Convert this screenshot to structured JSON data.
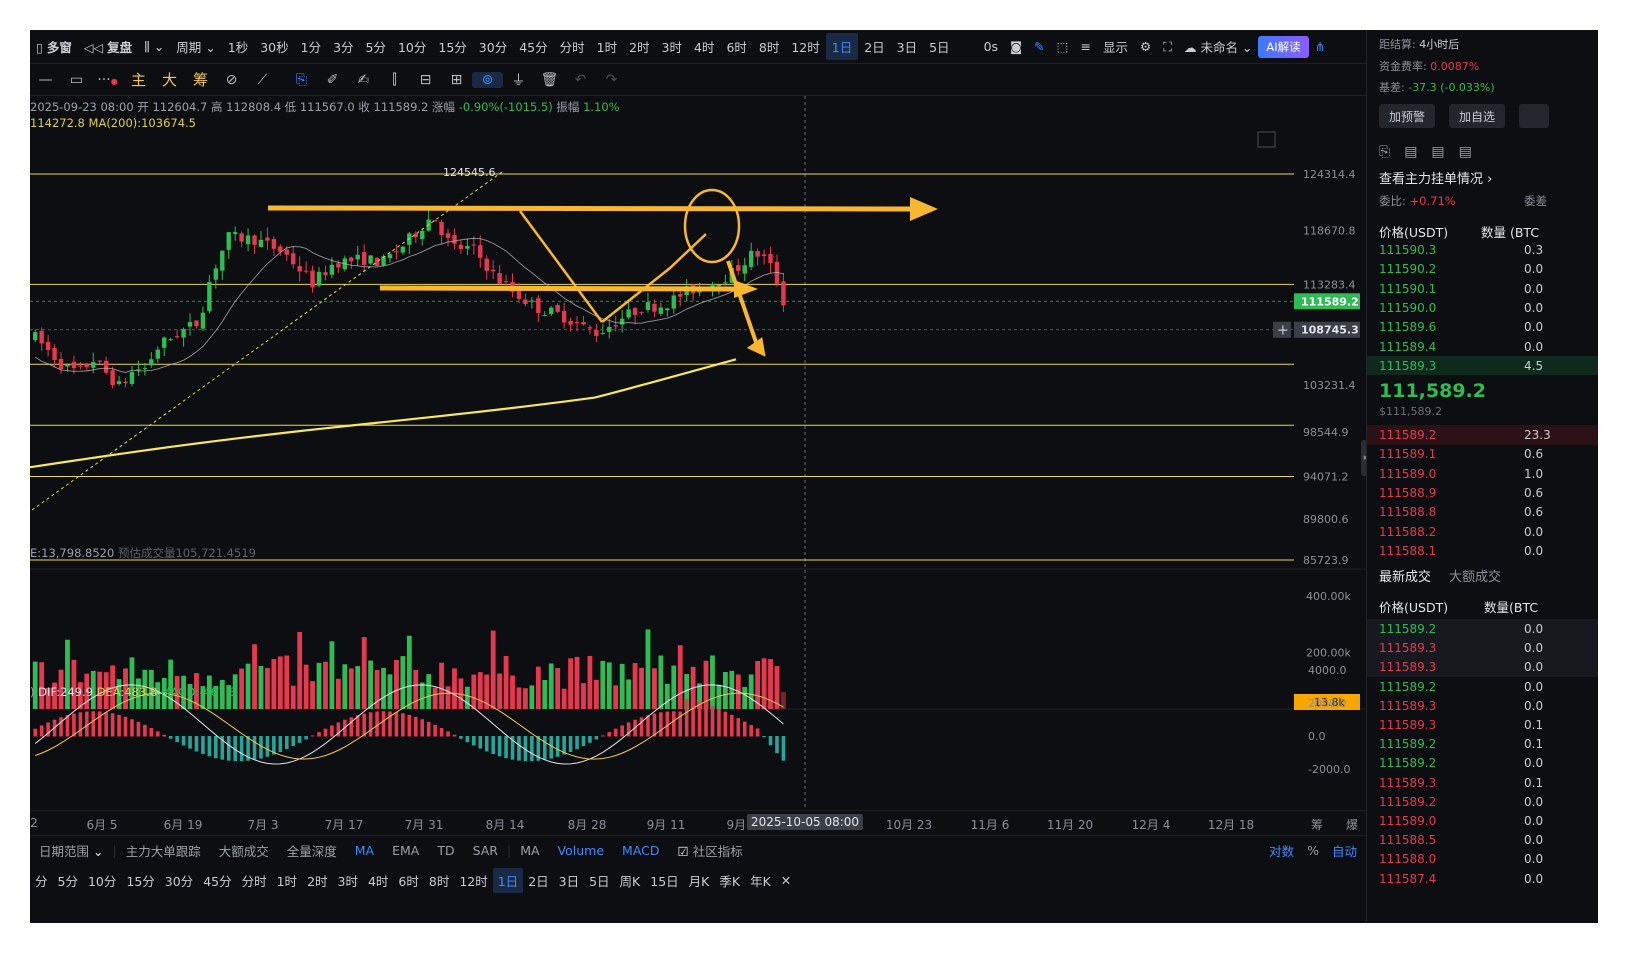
{
  "toolbar_top": {
    "items": [
      "多窗",
      "复盘",
      "周期",
      "1秒",
      "30秒",
      "1分",
      "3分",
      "5分",
      "10分",
      "15分",
      "30分",
      "45分",
      "分时",
      "1时",
      "2时",
      "3时",
      "4时",
      "6时",
      "8时",
      "12时",
      "1日",
      "2日",
      "3日",
      "5日",
      "0s",
      "显示",
      "未命名",
      "AI解读"
    ],
    "active": "1日"
  },
  "toolbar_draw": {
    "labels": [
      "主",
      "大",
      "筹"
    ]
  },
  "info": {
    "date": "2025-09-23 08:00",
    "open_label": "开",
    "open": "112604.7",
    "high_label": "高",
    "high": "112808.4",
    "low_label": "低",
    "low": "111567.0",
    "close_label": "收",
    "close": "111589.2",
    "change_label": "涨幅",
    "change": "-0.90%(-1015.5)",
    "amp_label": "振幅",
    "amp": "1.10%",
    "ma_left": "114272.8",
    "ma200": "MA(200):103674.5"
  },
  "volume_info": {
    "main": "E:13,798.8520",
    "est_label": "预估成交量",
    "est": "105,721.4519"
  },
  "macd_info": {
    "prefix": ")",
    "dif": "DIF:249.9",
    "dea": "DEA:483.8",
    "macd": "MACD:-467.8"
  },
  "chart_data": {
    "type": "candlestick",
    "price_ticks": [
      "124314.4",
      "118670.8",
      "113283.4",
      "103231.4",
      "98544.9",
      "94071.2",
      "89800.6",
      "85723.9"
    ],
    "current_price_tag": "111589.2",
    "crosshair_price_tag": "108745.3",
    "peak_label": "124545.6",
    "hlines": [
      124314.4,
      113283.4,
      105300,
      99200,
      94071.2,
      85723.9
    ],
    "volume_ticks": [
      "400.00k",
      "200.00k"
    ],
    "volume_tag": "13.8k",
    "macd_ticks": [
      "4000.0",
      "2000.0",
      "0.0",
      "-2000.0"
    ],
    "date_labels": [
      "2",
      "6月 5",
      "6月 19",
      "7月 3",
      "7月 17",
      "7月 31",
      "8月 14",
      "8月 28",
      "9月 11",
      "9月 2",
      "2025-10-05 08:00",
      "10月 23",
      "11月 6",
      "11月 20",
      "12月 4",
      "12月 18",
      "筹",
      "爆"
    ],
    "colors": {
      "up": "#2ebd55",
      "down": "#e8384f",
      "ma200": "#f5e663",
      "ma": "#b8b8b8",
      "arrow": "#f7b731",
      "hline": "#e6d84a"
    }
  },
  "bottom_bar": {
    "items": [
      "日期范围",
      "主力大单跟踪",
      "大额成交",
      "全量深度",
      "MA",
      "EMA",
      "TD",
      "SAR",
      "MA",
      "Volume",
      "MACD",
      "社区指标",
      "对数",
      "%",
      "自动"
    ]
  },
  "bottom_periods": {
    "items": [
      "分",
      "5分",
      "10分",
      "15分",
      "30分",
      "45分",
      "分时",
      "1时",
      "2时",
      "3时",
      "4时",
      "6时",
      "8时",
      "12时",
      "1日",
      "2日",
      "3日",
      "5日",
      "周K",
      "15日",
      "月K",
      "季K",
      "年K",
      "✕"
    ],
    "active": "1日"
  },
  "right_panel": {
    "settle_label": "距结算:",
    "settle_value": "4小时后",
    "funding_label": "资金费率:",
    "funding_value": "0.0087%",
    "basis_label": "基差:",
    "basis_value": "-37.3 (-0.033%)",
    "btn_alert": "加预警",
    "btn_fav": "加自选",
    "main_orders": "查看主力挂单情况",
    "ratio_label": "委比:",
    "ratio_value": "+0.71%",
    "ratio_right": "委差",
    "col_price": "价格(USDT)",
    "col_qty": "数量 (BTC",
    "bids": [
      {
        "p": "111590.3",
        "q": "0.3"
      },
      {
        "p": "111590.2",
        "q": "0.0"
      },
      {
        "p": "111590.1",
        "q": "0.0"
      },
      {
        "p": "111590.0",
        "q": "0.0"
      },
      {
        "p": "111589.6",
        "q": "0.0"
      },
      {
        "p": "111589.4",
        "q": "0.0"
      },
      {
        "p": "111589.3",
        "q": "4.5"
      }
    ],
    "last_price": "111,589.2",
    "last_usd": "$111,589.2",
    "asks": [
      {
        "p": "111589.2",
        "q": "23.3"
      },
      {
        "p": "111589.1",
        "q": "0.6"
      },
      {
        "p": "111589.0",
        "q": "1.0"
      },
      {
        "p": "111588.9",
        "q": "0.6"
      },
      {
        "p": "111588.8",
        "q": "0.6"
      },
      {
        "p": "111588.2",
        "q": "0.0"
      },
      {
        "p": "111588.1",
        "q": "0.0"
      }
    ],
    "trades_tab1": "最新成交",
    "trades_tab2": "大额成交",
    "trades_col_price": "价格(USDT)",
    "trades_col_qty": "数量(BTC",
    "trades": [
      {
        "p": "111589.2",
        "q": "0.0",
        "s": "g"
      },
      {
        "p": "111589.3",
        "q": "0.0",
        "s": "r"
      },
      {
        "p": "111589.3",
        "q": "0.0",
        "s": "r"
      },
      {
        "p": "111589.2",
        "q": "0.0",
        "s": "g"
      },
      {
        "p": "111589.3",
        "q": "0.0",
        "s": "r"
      },
      {
        "p": "111589.3",
        "q": "0.1",
        "s": "r"
      },
      {
        "p": "111589.2",
        "q": "0.1",
        "s": "g"
      },
      {
        "p": "111589.2",
        "q": "0.0",
        "s": "g"
      },
      {
        "p": "111589.3",
        "q": "0.1",
        "s": "r"
      },
      {
        "p": "111589.2",
        "q": "0.0",
        "s": "r"
      },
      {
        "p": "111589.0",
        "q": "0.0",
        "s": "r"
      },
      {
        "p": "111588.5",
        "q": "0.0",
        "s": "r"
      },
      {
        "p": "111588.0",
        "q": "0.0",
        "s": "r"
      },
      {
        "p": "111587.4",
        "q": "0.0",
        "s": "r"
      }
    ]
  }
}
